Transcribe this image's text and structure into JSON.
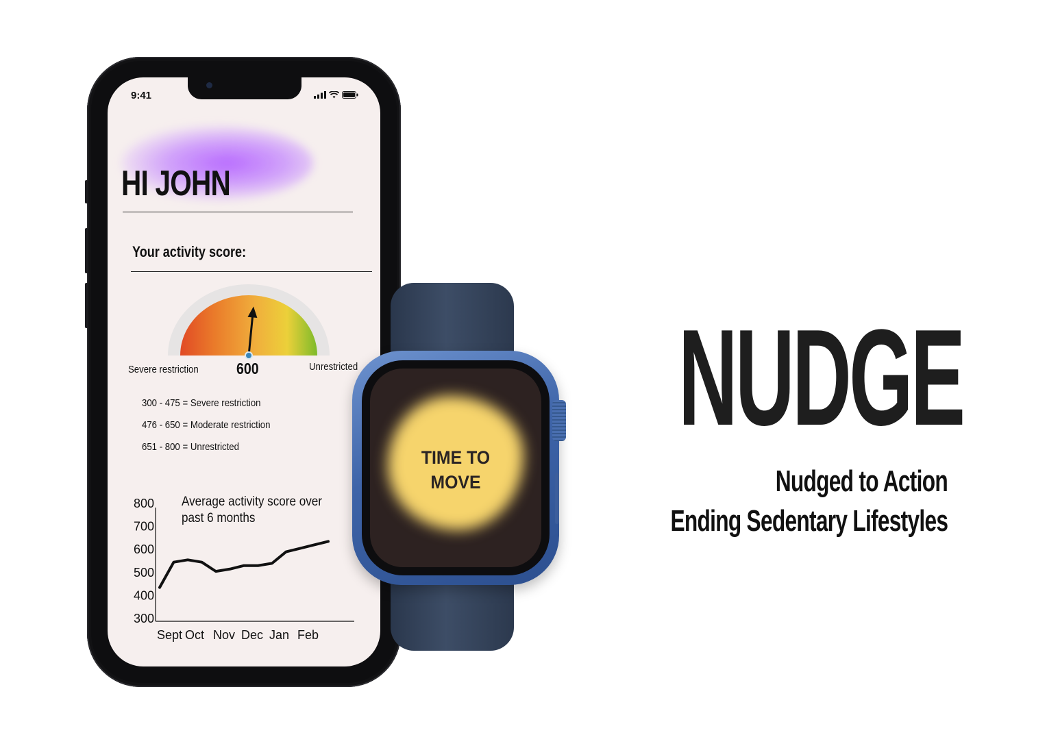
{
  "phone": {
    "status_time": "9:41",
    "greeting": "HI JOHN",
    "score_label": "Your activity score:",
    "gauge": {
      "value_text": "600",
      "score": 600,
      "min": 300,
      "max": 800,
      "left_label": "Severe restriction",
      "right_label": "Unrestricted"
    },
    "legend": [
      "300 - 475 = Severe restriction",
      "476 - 650 = Moderate restriction",
      "651 - 800 = Unrestricted"
    ],
    "chart_title": "Average activity score over past 6 months"
  },
  "chart_data": {
    "type": "line",
    "title": "Average activity score over past 6 months",
    "xlabel": "",
    "ylabel": "",
    "ylim": [
      300,
      800
    ],
    "y_ticks": [
      "800",
      "700",
      "600",
      "500",
      "400",
      "300"
    ],
    "categories": [
      "Sept",
      "Oct",
      "Nov",
      "Dec",
      "Jan",
      "Feb"
    ],
    "x": [
      0,
      0.5,
      1,
      1.5,
      2,
      2.5,
      3,
      3.5,
      4,
      4.5,
      5,
      5.5,
      6
    ],
    "values": [
      435,
      545,
      555,
      545,
      505,
      515,
      530,
      530,
      540,
      590,
      605,
      620,
      635
    ],
    "grid": false,
    "color": "#111111"
  },
  "watch": {
    "message": "TIME TO MOVE",
    "blob_color": "#f6d46c",
    "case_color": "#3e64a8",
    "band_color": "#33425a"
  },
  "brand": {
    "name": "NUDGE",
    "tagline1": "Nudged to Action",
    "tagline2": "Ending Sedentary Lifestyles"
  }
}
